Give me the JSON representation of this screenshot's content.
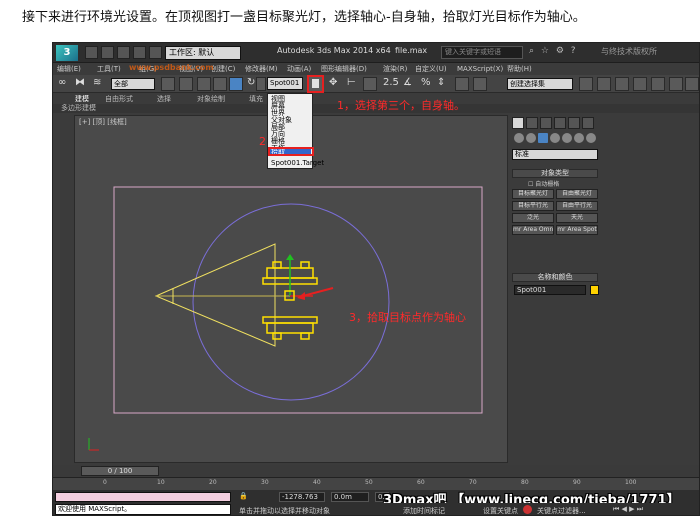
{
  "caption": "接下来进行环境光设置。在顶视图打一盏目标聚光灯，选择轴心-自身轴，拾取灯光目标作为轴心。",
  "titlebar": {
    "logo": "3",
    "workspace": "工作区: 默认",
    "app_title": "Autodesk 3ds Max  2014 x64",
    "file": "file.max",
    "search_placeholder": "键入关键字或短语",
    "watermark": "与终技术版权所"
  },
  "menus": [
    "编辑(E)",
    "工具(T)",
    "组(G)",
    "视图(V)",
    "创建(C)",
    "修改器(M)",
    "动画(A)",
    "图形编辑器(D)",
    "渲染(R)",
    "自定义(U)",
    "MAXScript(X)",
    "帮助(H)"
  ],
  "toolbar": {
    "selection_filter": "全部",
    "pivot_value": "Spot001",
    "named_set": "创建选择集",
    "watermark": "www.psdbank.com"
  },
  "ribbon": {
    "tabs": [
      "建模",
      "自由形式",
      "选择",
      "对象绘制",
      "填充"
    ],
    "active_tab": "建模",
    "sub_label": "多边形建模"
  },
  "pivot_dropdown": {
    "items": [
      "视图",
      "屏幕",
      "世界",
      "父对象",
      "局部",
      "万向",
      "栅格",
      "工作",
      "拾取",
      "Spot001.Target"
    ],
    "selected": "拾取"
  },
  "viewport": {
    "label": "[+] [顶] [线框]"
  },
  "annotations": {
    "step1": "1，选择第三个，自身轴。",
    "step2": "2",
    "step3": "3，拾取目标点作为轴心"
  },
  "command_panel": {
    "category": "标准",
    "object_type_title": "对象类型",
    "autogrid": "自动栅格",
    "buttons": [
      "目标聚光灯",
      "自由聚光灯",
      "目标平行光",
      "自由平行光",
      "泛光",
      "天光",
      "mr Area Omni",
      "mr Area Spot"
    ],
    "name_color_title": "名称和颜色",
    "object_name": "Spot001",
    "swatch_color": "#ffd200"
  },
  "timeline": {
    "slider": "0 / 100",
    "ticks": [
      "0",
      "10",
      "20",
      "30",
      "40",
      "50",
      "60",
      "70",
      "80",
      "90",
      "100"
    ]
  },
  "status": {
    "maxscript": "欢迎使用 MAXScript。",
    "prompt": "单击并拖动以选择并移动对象",
    "x": "-1278.763",
    "y": "0.0m",
    "z": "0.0m",
    "add_time_tag": "添加时间标记",
    "set_key": "设置关键点",
    "key_filter": "关键点过滤器...",
    "watermark": "3Dmax吧 【www.linecg.com/tieba/1771】"
  }
}
